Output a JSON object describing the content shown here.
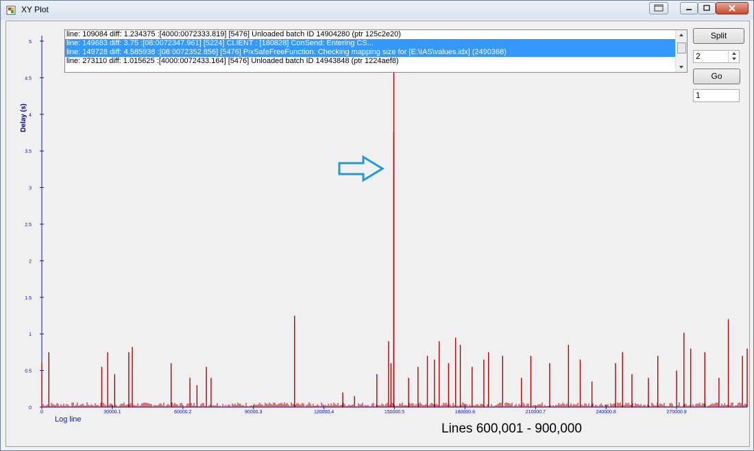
{
  "window": {
    "title": "XY Plot"
  },
  "controls": {
    "split_label": "Split",
    "split_value": "2",
    "go_label": "Go",
    "go_value": "1"
  },
  "log_list": {
    "rows": [
      {
        "text": "line: 109084 diff: 1.234375  :[4000:0072333.819] [5476] Unloaded batch ID 14904280 (ptr 125c2e20)",
        "selected": false
      },
      {
        "text": "line: 149683 diff: 3.75  :[08:0072347.961] [5224] CLIENT : [180828] ConSend: Entering CS...",
        "selected": true
      },
      {
        "text": "line: 149728 diff: 4.585938  :[08:0072352.856] [5476] PixSafeFreeFunction: Checking mapping size for [E:\\IAS\\values.idx] (2490368)",
        "selected": true
      },
      {
        "text": "line: 273110 diff: 1.015625  :[4000:0072433.164] [5476] Unloaded batch ID 14943848 (ptr 1224aef8)",
        "selected": false
      }
    ]
  },
  "chart_data": {
    "type": "line",
    "title": "",
    "xlabel": "Log line",
    "ylabel": "Delay (s)",
    "xlim": [
      0,
      300000
    ],
    "ylim": [
      0,
      5
    ],
    "x_ticks": [
      "0",
      "30000.1",
      "60000.2",
      "90000.3",
      "120000.4",
      "150000.5",
      "180000.6",
      "210000.7",
      "240000.8",
      "270000.9"
    ],
    "x_tick_values": [
      0,
      30000.1,
      60000.2,
      90000.3,
      120000.4,
      150000.5,
      180000.6,
      210000.7,
      240000.8,
      270000.9
    ],
    "y_ticks": [
      "0",
      "0.5",
      "1",
      "1.5",
      "2",
      "2.5",
      "3",
      "3.5",
      "4",
      "4.5",
      "5"
    ],
    "y_tick_values": [
      0,
      0.5,
      1,
      1.5,
      2,
      2.5,
      3,
      3.5,
      4,
      4.5,
      5
    ],
    "series": [
      {
        "color": "#b00000",
        "spikes": [
          [
            0,
            0.6
          ],
          [
            3000,
            0.75
          ],
          [
            25500,
            0.55
          ],
          [
            28000,
            0.75
          ],
          [
            31000,
            0.45
          ],
          [
            37000,
            0.75
          ],
          [
            38500,
            0.82
          ],
          [
            55000,
            0.6
          ],
          [
            63000,
            0.4
          ],
          [
            66000,
            0.3
          ],
          [
            70000,
            0.55
          ],
          [
            72000,
            0.4
          ],
          [
            107500,
            1.25
          ],
          [
            128000,
            0.2
          ],
          [
            133000,
            0.15
          ],
          [
            142500,
            0.45
          ],
          [
            147500,
            0.9
          ],
          [
            148500,
            0.6
          ],
          [
            149683,
            3.75
          ],
          [
            149728,
            4.585938
          ],
          [
            156000,
            0.4
          ],
          [
            160000,
            0.55
          ],
          [
            164000,
            0.7
          ],
          [
            167000,
            0.65
          ],
          [
            169000,
            0.9
          ],
          [
            173000,
            0.6
          ],
          [
            176000,
            0.95
          ],
          [
            178000,
            0.85
          ],
          [
            183000,
            0.55
          ],
          [
            188000,
            0.65
          ],
          [
            190000,
            0.75
          ],
          [
            196000,
            0.7
          ],
          [
            204000,
            0.4
          ],
          [
            208000,
            0.7
          ],
          [
            216000,
            0.6
          ],
          [
            224000,
            0.85
          ],
          [
            229000,
            0.65
          ],
          [
            234000,
            0.35
          ],
          [
            244000,
            0.6
          ],
          [
            247000,
            0.75
          ],
          [
            251000,
            0.45
          ],
          [
            258000,
            0.4
          ],
          [
            262000,
            0.7
          ],
          [
            270000,
            0.5
          ],
          [
            273110,
            1.015625
          ],
          [
            276000,
            0.8
          ],
          [
            282000,
            0.75
          ],
          [
            288000,
            0.4
          ],
          [
            292000,
            1.2
          ],
          [
            298000,
            0.7
          ],
          [
            300000,
            0.8
          ]
        ]
      }
    ]
  },
  "annotation": {
    "caption": "Lines 600,001 - 900,000",
    "arrow_color": "#1e9ad6"
  }
}
